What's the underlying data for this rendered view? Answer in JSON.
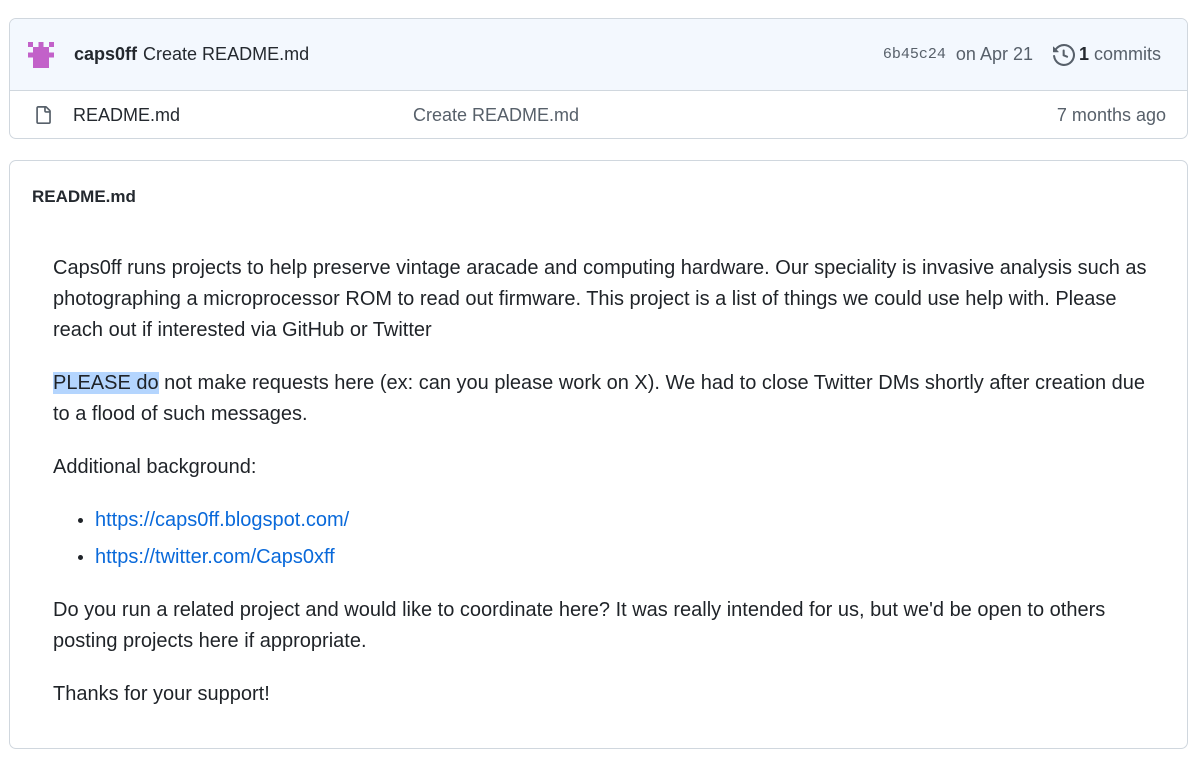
{
  "commit_bar": {
    "author": "caps0ff",
    "message": "Create README.md",
    "sha": "6b45c24",
    "date": "on Apr 21",
    "commit_count": "1",
    "commits_label": "commits"
  },
  "files": [
    {
      "name": "README.md",
      "last_commit": "Create README.md",
      "age": "7 months ago"
    }
  ],
  "readme": {
    "title": "README.md",
    "intro": "Caps0ff runs projects to help preserve vintage aracade and computing hardware. Our speciality is invasive analysis such as photographing a microprocessor ROM to read out firmware. This project is a list of things we could use help with. Please reach out if interested via GitHub or Twitter",
    "please_highlighted": "PLEASE do",
    "please_rest": " not make requests here (ex: can you please work on X). We had to close Twitter DMs shortly after creation due to a flood of such messages.",
    "background_label": "Additional background:",
    "links": [
      "https://caps0ff.blogspot.com/",
      "https://twitter.com/Caps0xff"
    ],
    "coordinate": "Do you run a related project and would like to coordinate here? It was really intended for us, but we'd be open to others posting projects here if appropriate.",
    "thanks": "Thanks for your support!"
  },
  "colors": {
    "link": "#0969da",
    "commit_bar_bg": "#f3f8fe",
    "border": "#d0d7de",
    "selection": "#b4d5fe",
    "avatar": "#c261c9"
  },
  "icons": {
    "avatar": "identicon",
    "history": "history-icon",
    "file": "file-icon"
  }
}
